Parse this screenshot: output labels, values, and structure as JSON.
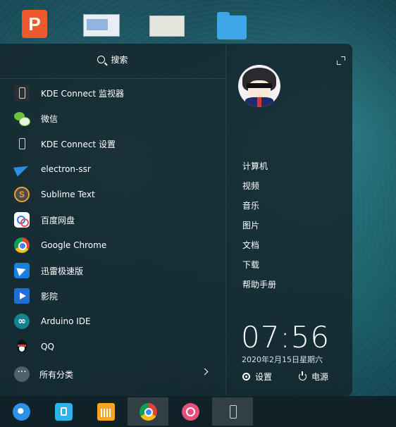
{
  "launcher": {
    "search_label": "搜索",
    "apps": [
      {
        "label": "KDE Connect 监视器",
        "icon": "kde-connect-monitor-icon"
      },
      {
        "label": "微信",
        "icon": "wechat-icon"
      },
      {
        "label": "KDE Connect 设置",
        "icon": "kde-connect-settings-icon"
      },
      {
        "label": "electron-ssr",
        "icon": "paper-plane-icon"
      },
      {
        "label": "Sublime Text",
        "icon": "sublime-text-icon"
      },
      {
        "label": "百度网盘",
        "icon": "baidu-netdisk-icon"
      },
      {
        "label": "Google Chrome",
        "icon": "chrome-icon"
      },
      {
        "label": "迅雷极速版",
        "icon": "xunlei-icon"
      },
      {
        "label": "影院",
        "icon": "movie-player-icon"
      },
      {
        "label": "Arduino IDE",
        "icon": "arduino-icon"
      },
      {
        "label": "QQ",
        "icon": "qq-icon"
      }
    ],
    "all_categories_label": "所有分类",
    "places": [
      "计算机",
      "视频",
      "音乐",
      "图片",
      "文档",
      "下载",
      "帮助手册"
    ],
    "clock": {
      "time": "07:56",
      "date": "2020年2月15日星期六"
    },
    "settings_label": "设置",
    "power_label": "电源"
  },
  "desktop": {
    "icons": [
      "wps-presentation-icon",
      "screenshot-thumbnail-icon",
      "map-thumbnail-icon",
      "folder-icon"
    ],
    "wps_glyph": "P"
  },
  "dock": {
    "items": [
      "deepin-launcher-icon",
      "app-store-icon",
      "archive-manager-icon",
      "chrome-icon",
      "control-center-icon",
      "kde-connect-icon"
    ],
    "active": "chrome-icon"
  }
}
